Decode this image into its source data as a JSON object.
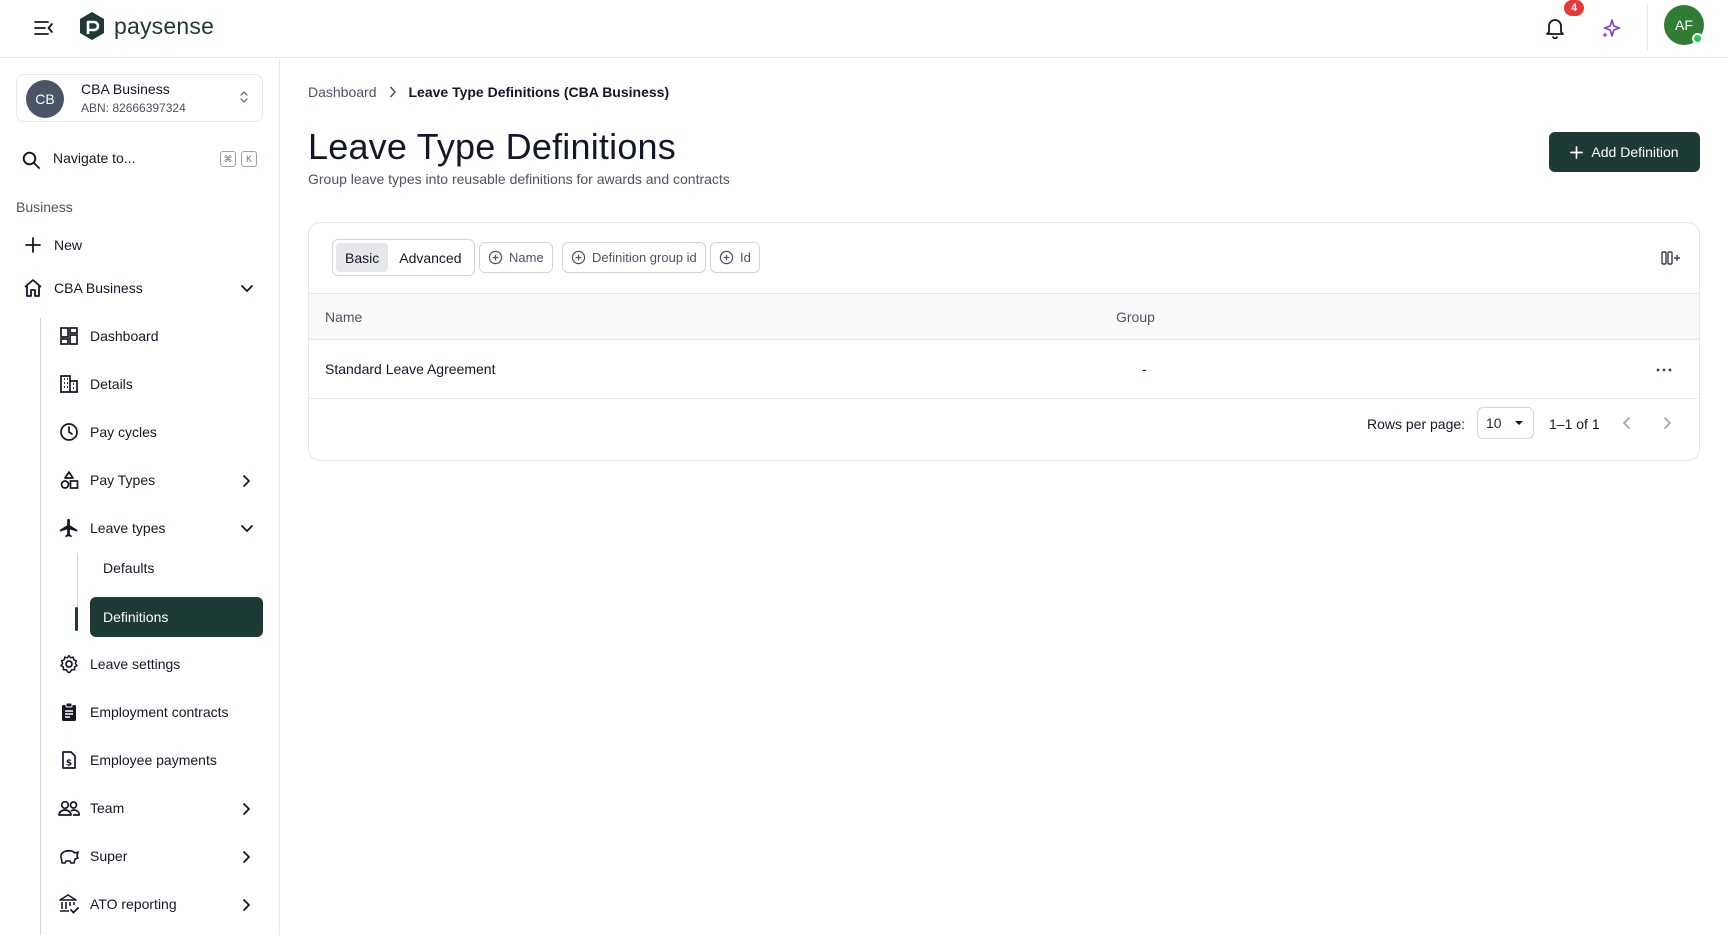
{
  "app": {
    "brand": "paysense",
    "notifications_count": "4",
    "user_initials": "AF"
  },
  "sidebar": {
    "business": {
      "initials": "CB",
      "name": "CBA Business",
      "abn": "ABN: 82666397324"
    },
    "navigate": {
      "label": "Navigate to...",
      "kbd_1": "⌘",
      "kbd_2": "K"
    },
    "section_label": "Business",
    "new_label": "New",
    "business_group_label": "CBA Business",
    "items": {
      "dashboard": "Dashboard",
      "details": "Details",
      "pay_cycles": "Pay cycles",
      "pay_types": "Pay Types",
      "leave_types": "Leave types",
      "defaults": "Defaults",
      "definitions": "Definitions",
      "leave_settings": "Leave settings",
      "employment_contracts": "Employment contracts",
      "employee_payments": "Employee payments",
      "team": "Team",
      "super": "Super",
      "ato_reporting": "ATO reporting"
    }
  },
  "breadcrumb": {
    "root": "Dashboard",
    "current": "Leave Type Definitions (CBA Business)"
  },
  "page": {
    "title": "Leave Type Definitions",
    "subtitle": "Group leave types into reusable definitions for awards and contracts",
    "add_button": "Add Definition"
  },
  "filters": {
    "mode_basic": "Basic",
    "mode_advanced": "Advanced",
    "chip_name": "Name",
    "chip_group": "Definition group id",
    "chip_id": "Id"
  },
  "table": {
    "columns": [
      "Name",
      "Group"
    ],
    "rows": [
      {
        "name": "Standard Leave Agreement",
        "group": "-"
      }
    ]
  },
  "pagination": {
    "rows_per_page_label": "Rows per page:",
    "rows_per_page": "10",
    "range": "1–1 of 1"
  },
  "colors": {
    "primary": "#1e3a36",
    "badge": "#e53935",
    "avatar": "#2e7d32",
    "sparkle": "#7c3aed"
  }
}
